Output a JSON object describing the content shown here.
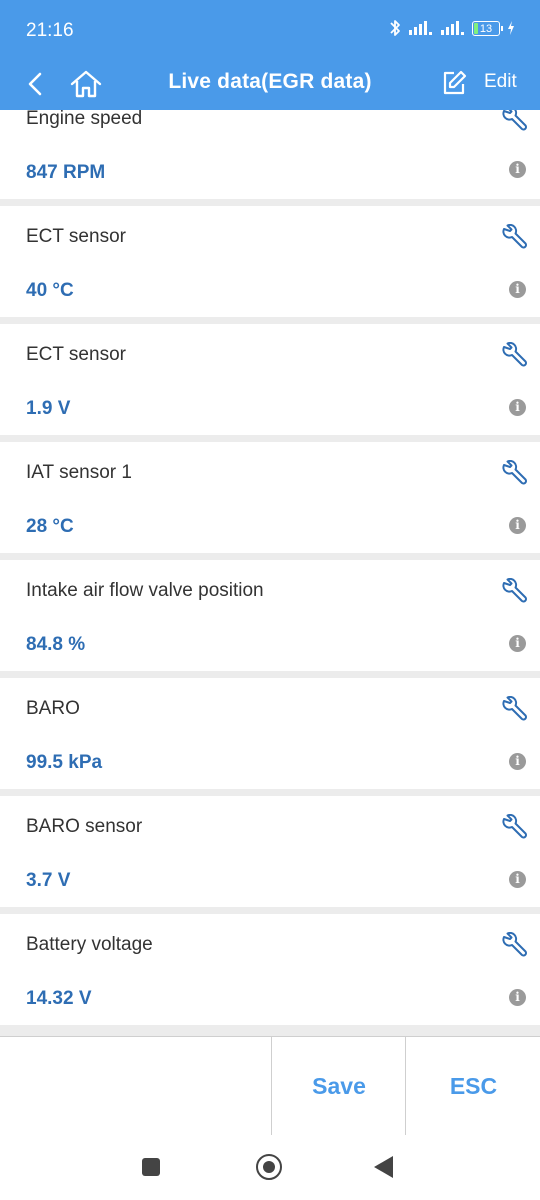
{
  "status_bar": {
    "time": "21:16",
    "battery_level": "13",
    "icons": [
      "bluetooth-icon",
      "signal-icon",
      "signal-icon",
      "battery-icon",
      "charging-icon"
    ]
  },
  "app_bar": {
    "title": "Live data(EGR data)",
    "edit_label": "Edit",
    "background": "#4a9ae9"
  },
  "items": [
    {
      "label": "Engine speed",
      "value": "847 RPM"
    },
    {
      "label": "ECT sensor",
      "value": "40 °C"
    },
    {
      "label": "ECT sensor",
      "value": "1.9 V"
    },
    {
      "label": "IAT sensor 1",
      "value": "28 °C"
    },
    {
      "label": "Intake air flow valve position",
      "value": "84.8 %"
    },
    {
      "label": "BARO",
      "value": "99.5 kPa"
    },
    {
      "label": "BARO sensor",
      "value": "3.7 V"
    },
    {
      "label": "Battery voltage",
      "value": "14.32 V"
    }
  ],
  "info_glyph": "i",
  "actions": {
    "save_label": "Save",
    "esc_label": "ESC"
  },
  "colors": {
    "accent": "#4a9ae9",
    "value_text": "#2e6db3"
  }
}
